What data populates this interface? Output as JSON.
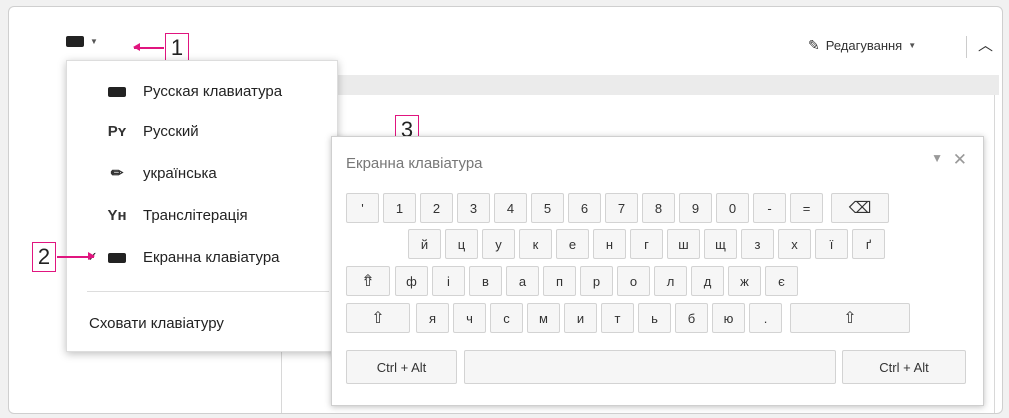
{
  "toolbar": {
    "edit_mode_label": "Редагування"
  },
  "callouts": {
    "one": "1",
    "two": "2",
    "three": "3"
  },
  "menu": {
    "items": [
      {
        "icon": "keyboard-icon",
        "label": "Русская клавиатура",
        "checked": false
      },
      {
        "icon": "Рʏ",
        "label": "Русский",
        "checked": false
      },
      {
        "icon": "pencil-icon",
        "label": "українська",
        "checked": false
      },
      {
        "icon": "Yʜ",
        "label": "Транслітерація",
        "checked": false
      },
      {
        "icon": "keyboard-icon",
        "label": "Екранна клавіатура",
        "checked": true
      }
    ],
    "check_glyph": "✓",
    "hide_label": "Сховати клавіатуру"
  },
  "vk": {
    "title": "Екранна клавіатура",
    "minimize_glyph": "▼",
    "close_glyph": "✕",
    "rows": [
      [
        "'",
        "1",
        "2",
        "3",
        "4",
        "5",
        "6",
        "7",
        "8",
        "9",
        "0",
        "-",
        "=",
        "⌫"
      ],
      [
        "й",
        "ц",
        "у",
        "к",
        "е",
        "н",
        "г",
        "ш",
        "щ",
        "з",
        "х",
        "ї",
        "ґ"
      ],
      [
        "⇮",
        "ф",
        "і",
        "в",
        "а",
        "п",
        "р",
        "о",
        "л",
        "д",
        "ж",
        "є"
      ],
      [
        "⇧",
        "я",
        "ч",
        "с",
        "м",
        "и",
        "т",
        "ь",
        "б",
        "ю",
        ".",
        "⇧"
      ],
      [
        "Ctrl + Alt",
        "",
        "Ctrl + Alt"
      ]
    ]
  },
  "colors": {
    "accent": "#e0157f"
  }
}
